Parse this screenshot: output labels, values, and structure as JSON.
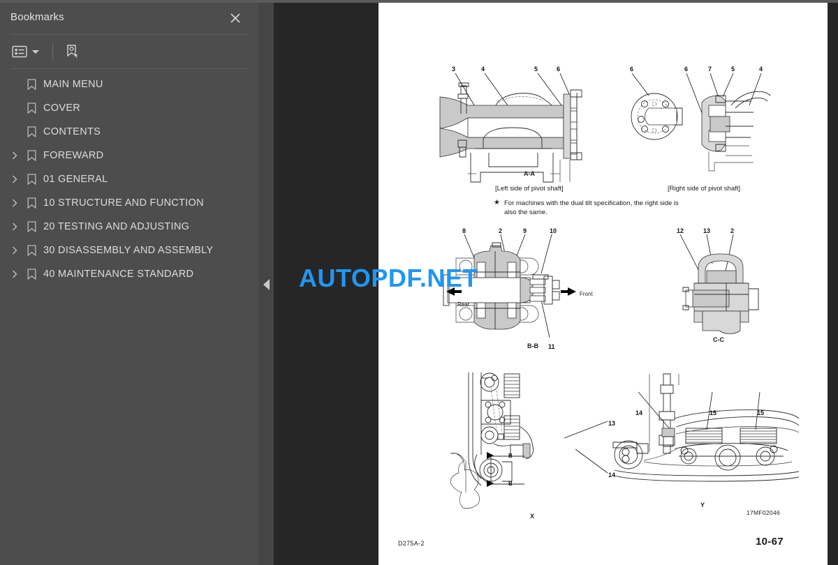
{
  "sidebar": {
    "title": "Bookmarks",
    "close_icon": "close-icon",
    "toolbar": {
      "options_icon": "list-options-icon",
      "caret_icon": "chevron-down-icon",
      "select_bookmark_icon": "bookmark-pointer-icon"
    },
    "items": [
      {
        "label": "MAIN MENU",
        "expandable": false
      },
      {
        "label": "COVER",
        "expandable": false
      },
      {
        "label": "CONTENTS",
        "expandable": false
      },
      {
        "label": "FOREWARD",
        "expandable": true
      },
      {
        "label": "01 GENERAL",
        "expandable": true
      },
      {
        "label": "10 STRUCTURE AND FUNCTION",
        "expandable": true
      },
      {
        "label": "20 TESTING AND ADJUSTING",
        "expandable": true
      },
      {
        "label": "30 DISASSEMBLY AND ASSEMBLY",
        "expandable": true
      },
      {
        "label": "40 MAINTENANCE STANDARD",
        "expandable": true
      }
    ]
  },
  "splitter": {
    "collapse_icon": "collapse-left-triangle-icon"
  },
  "watermark": {
    "text": "AUTOPDF.NET",
    "color": "#2196f3"
  },
  "page": {
    "footer_left": "D275A-2",
    "footer_right": "10-67",
    "drawing_number": "17MF02046",
    "note": "For machines with the dual tilt specification, the right side is also the same.",
    "note_bullet": "★",
    "figures": [
      {
        "name": "section-a-a",
        "section_label": "A-A",
        "caption": "[Left side of pivot shaft]",
        "callouts": [
          "3",
          "4",
          "5",
          "6"
        ]
      },
      {
        "name": "right-side-pivot-shaft",
        "section_label": "",
        "caption": "[Right side of pivot shaft]",
        "callouts": [
          "6",
          "6",
          "7",
          "5",
          "4"
        ]
      },
      {
        "name": "section-b-b",
        "section_label": "B-B",
        "caption": "",
        "callouts": [
          "8",
          "2",
          "9",
          "10",
          "11"
        ],
        "direction_labels": [
          "Rear",
          "Front"
        ]
      },
      {
        "name": "section-c-c",
        "section_label": "C-C",
        "caption": "",
        "callouts": [
          "12",
          "13",
          "2"
        ]
      },
      {
        "name": "view-x",
        "section_label": "X",
        "caption": "",
        "callouts": [
          "13",
          "14",
          "B",
          "B"
        ]
      },
      {
        "name": "view-y",
        "section_label": "Y",
        "caption": "",
        "callouts": [
          "14",
          "15",
          "15"
        ]
      }
    ]
  }
}
